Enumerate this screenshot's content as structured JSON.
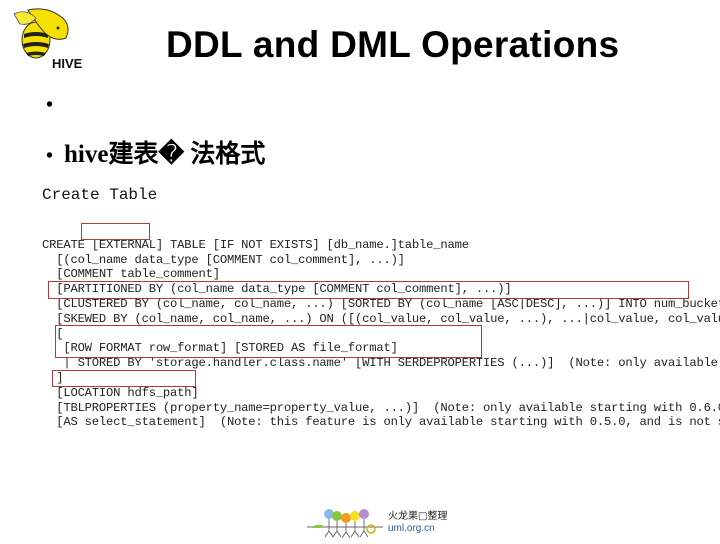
{
  "slide": {
    "title": "DDL and DML Operations",
    "logo_label": "HIVE",
    "bullets": [
      {
        "text": ""
      },
      {
        "text": "hive建表� 法格式"
      }
    ],
    "bullet_char": "•"
  },
  "code": {
    "heading": "Create Table",
    "lines": [
      "CREATE [EXTERNAL] TABLE [IF NOT EXISTS] [db_name.]table_name",
      "  [(col_name data_type [COMMENT col_comment], ...)]",
      "  [COMMENT table_comment]",
      "  [PARTITIONED BY (col_name data_type [COMMENT col_comment], ...)]",
      "  [CLUSTERED BY (col_name, col_name, ...) [SORTED BY (col_name [ASC|DESC], ...)] INTO num_buckets BUCKETS]",
      "  [SKEWED BY (col_name, col_name, ...) ON ([(col_value, col_value, ...), ...|col_value, col_value, ...]) (N",
      "  [",
      "   [ROW FORMAT row_format] [STORED AS file_format]",
      "   | STORED BY 'storage.handler.class.name' [WITH SERDEPROPERTIES (...)]  (Note: only available starting wi",
      "  ]",
      "  [LOCATION hdfs_path]",
      "  [TBLPROPERTIES (property_name=property_value, ...)]  (Note: only available starting with 0.6.0)",
      "  [AS select_statement]  (Note: this feature is only available starting with 0.5.0, and is not supported wh"
    ],
    "highlight_color": "#b23a3a"
  },
  "footer": {
    "site_name": "火龙果□整理",
    "site_url": "uml.org.cn"
  }
}
